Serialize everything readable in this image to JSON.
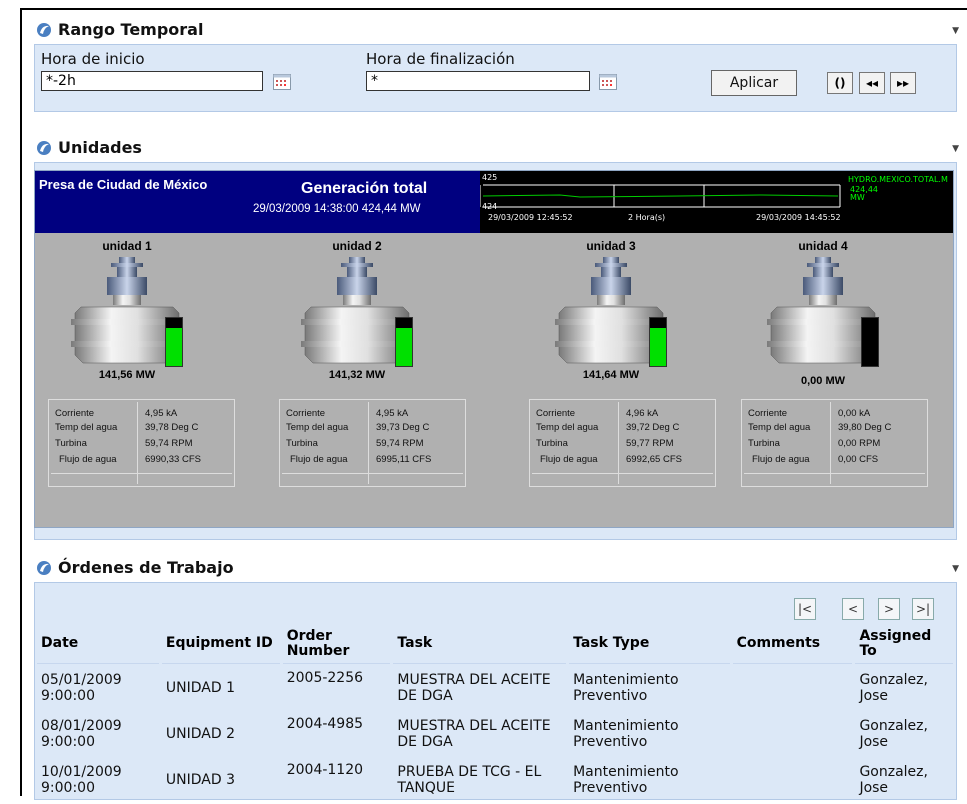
{
  "time_range": {
    "title": "Rango Temporal",
    "start_label": "Hora de inicio",
    "start_value": "*-2h",
    "end_label": "Hora de finalización",
    "end_value": "*",
    "apply_label": "Aplicar",
    "refresh_glyph": "()",
    "back_glyph": "◂◂",
    "forward_glyph": "▸▸"
  },
  "units": {
    "title": "Unidades",
    "plant_name": "Presa de Ciudad de México",
    "gen_title": "Generación total",
    "gen_value": "29/03/2009 14:38:00 424,44 MW",
    "trend": {
      "y_top": "425",
      "y_bottom": "424",
      "start_time": "29/03/2009 12:45:52",
      "duration": "2 Hora(s)",
      "end_time": "29/03/2009 14:45:52",
      "tag": "HYDRO.MEXICO.TOTAL.M",
      "tag_value": "424,44",
      "tag_unit": "MW"
    },
    "labels": {
      "current": "Corriente",
      "water_temp": "Temp del agua",
      "turbine": "Turbina",
      "water_flow": "Flujo de agua"
    },
    "list": [
      {
        "name": "unidad 1",
        "mw": "141,56 MW",
        "level": 0.8,
        "current": "4,95 kA",
        "temp": "39,78 Deg C",
        "rpm": "59,74 RPM",
        "flow": "6990,33 CFS"
      },
      {
        "name": "unidad 2",
        "mw": "141,32 MW",
        "level": 0.8,
        "current": "4,95 kA",
        "temp": "39,73 Deg C",
        "rpm": "59,74 RPM",
        "flow": "6995,11 CFS"
      },
      {
        "name": "unidad 3",
        "mw": "141,64 MW",
        "level": 0.8,
        "current": "4,96 kA",
        "temp": "39,72 Deg C",
        "rpm": "59,77 RPM",
        "flow": "6992,65 CFS"
      },
      {
        "name": "unidad 4",
        "mw": "0,00 MW",
        "level": 0.0,
        "current": "0,00 kA",
        "temp": "39,80 Deg C",
        "rpm": "0,00 RPM",
        "flow": "0,00 CFS"
      }
    ]
  },
  "work_orders": {
    "title": "Órdenes de Trabajo",
    "pager": [
      "|<",
      "<",
      ">",
      ">|"
    ],
    "columns": [
      "Date",
      "Equipment ID",
      "Order Number",
      "Task",
      "Task Type",
      "Comments",
      "Assigned To"
    ],
    "rows": [
      [
        "05/01/2009 9:00:00",
        "UNIDAD 1",
        "2005-2256",
        "MUESTRA DEL ACEITE DE DGA",
        "Mantenimiento Preventivo",
        "",
        "Gonzalez, Jose"
      ],
      [
        "08/01/2009 9:00:00",
        "UNIDAD 2",
        "2004-4985",
        "MUESTRA DEL ACEITE DE DGA",
        "Mantenimiento Preventivo",
        "",
        "Gonzalez, Jose"
      ],
      [
        "10/01/2009 9:00:00",
        "UNIDAD 3",
        "2004-1120",
        "PRUEBA DE TCG - EL TANQUE",
        "Mantenimiento Preventivo",
        "",
        "Gonzalez, Jose"
      ]
    ]
  },
  "colors": {
    "panel": "#dce8f7",
    "navy": "#000080",
    "level_green": "#00e000"
  },
  "icons": [
    "pi-section-icon",
    "calendar-icon",
    "collapse-arrow-icon"
  ]
}
